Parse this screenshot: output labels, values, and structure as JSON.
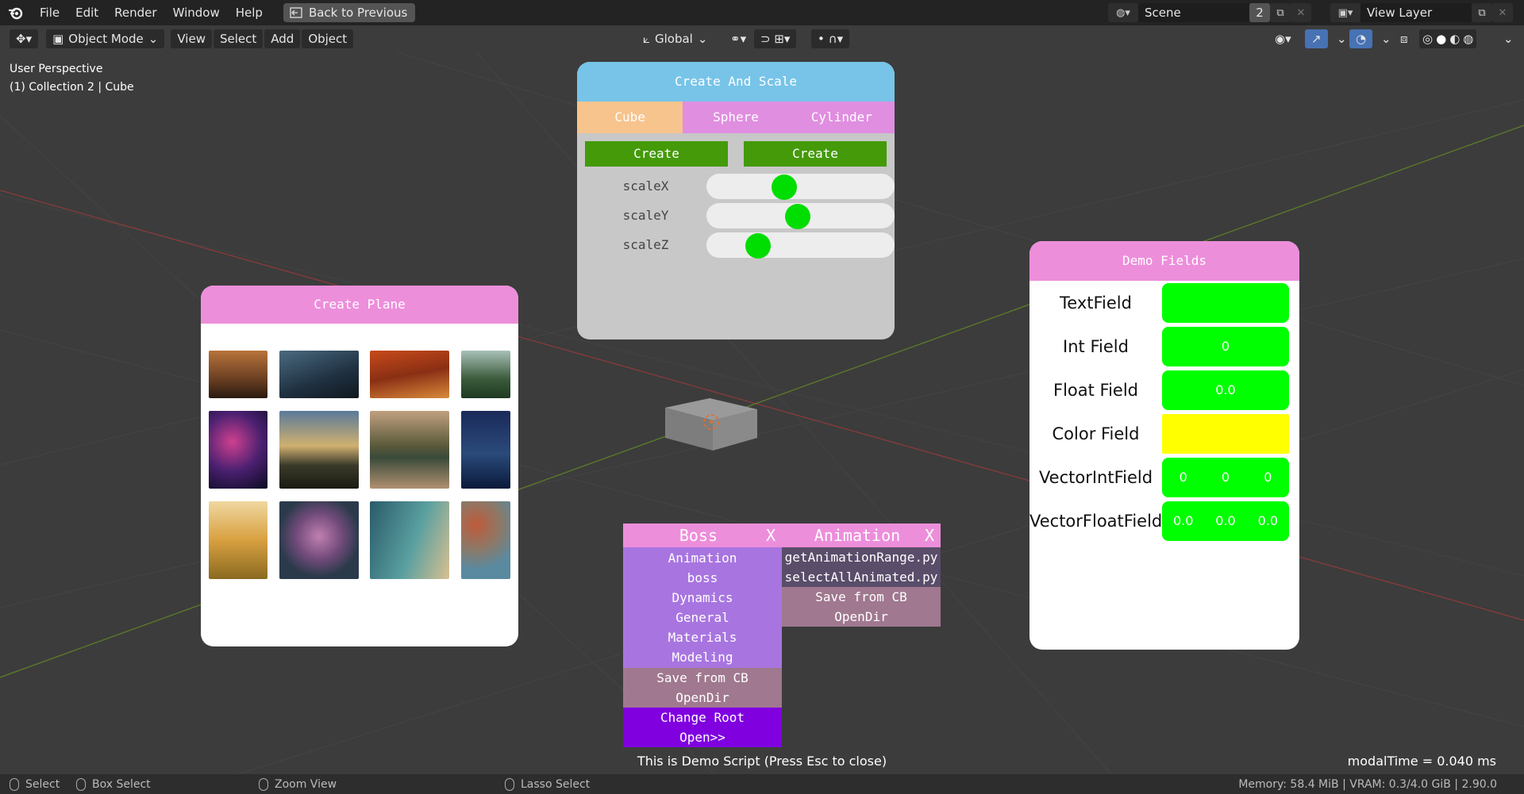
{
  "topbar": {
    "menus": [
      "File",
      "Edit",
      "Render",
      "Window",
      "Help"
    ],
    "back_button": "Back to Previous",
    "scene_name": "Scene",
    "scene_users": "2",
    "view_layer": "View Layer"
  },
  "view_header": {
    "mode": "Object Mode",
    "menus": [
      "View",
      "Select",
      "Add",
      "Object"
    ],
    "orientation": "Global"
  },
  "viewport": {
    "perspective": "User Perspective",
    "collection": "(1) Collection 2 | Cube"
  },
  "create_and_scale": {
    "title": "Create And Scale",
    "tabs": [
      "Cube",
      "Sphere",
      "Cylinder"
    ],
    "active_tab": "Cube",
    "create_label": "Create",
    "sliders": [
      {
        "label": "scaleX",
        "value": 0.41
      },
      {
        "label": "scaleY",
        "value": 0.48
      },
      {
        "label": "scaleZ",
        "value": 0.27
      }
    ]
  },
  "create_plane": {
    "title": "Create Plane",
    "thumbnails": [
      "desert-sunset",
      "elephant-forest",
      "autumn-road",
      "pine-forest",
      "milky-way",
      "mountain-clouds",
      "lake-reflection",
      "night-lake",
      "poppies",
      "rose",
      "beach-aerial",
      "pebbles"
    ]
  },
  "demo_fields": {
    "title": "Demo Fields",
    "rows": [
      {
        "label": "TextField",
        "values": []
      },
      {
        "label": "Int Field",
        "values": [
          "0"
        ]
      },
      {
        "label": "Float Field",
        "values": [
          "0.0"
        ]
      },
      {
        "label": "Color Field",
        "values": []
      },
      {
        "label": "VectorIntField",
        "values": [
          "0",
          "0",
          "0"
        ]
      },
      {
        "label": "VectorFloatField",
        "values": [
          "0.0",
          "0.0",
          "0.0"
        ]
      }
    ],
    "colors": {
      "field": "#00ff00",
      "color_field": "#ffff00"
    }
  },
  "boss_menu": {
    "title": "Boss",
    "close": "X",
    "items": [
      "Animation",
      "boss",
      "Dynamics",
      "General",
      "Materials",
      "Modeling"
    ],
    "actions": [
      "Save from CB",
      "OpenDir"
    ],
    "footer": [
      "Change Root",
      "Open>>"
    ]
  },
  "animation_menu": {
    "title": "Animation",
    "close": "X",
    "items": [
      "getAnimationRange.py",
      "selectAllAnimated.py"
    ],
    "actions": [
      "Save from CB",
      "OpenDir"
    ]
  },
  "bottom": {
    "demo_message": "This is Demo Script (Press Esc to close)",
    "modal_time": "modalTime = 0.040 ms"
  },
  "statusbar": {
    "select": "Select",
    "box_select": "Box Select",
    "zoom_view": "Zoom View",
    "lasso_select": "Lasso Select",
    "memory": "Memory: 58.4 MiB | VRAM: 0.3/4.0 GiB | 2.90.0"
  }
}
